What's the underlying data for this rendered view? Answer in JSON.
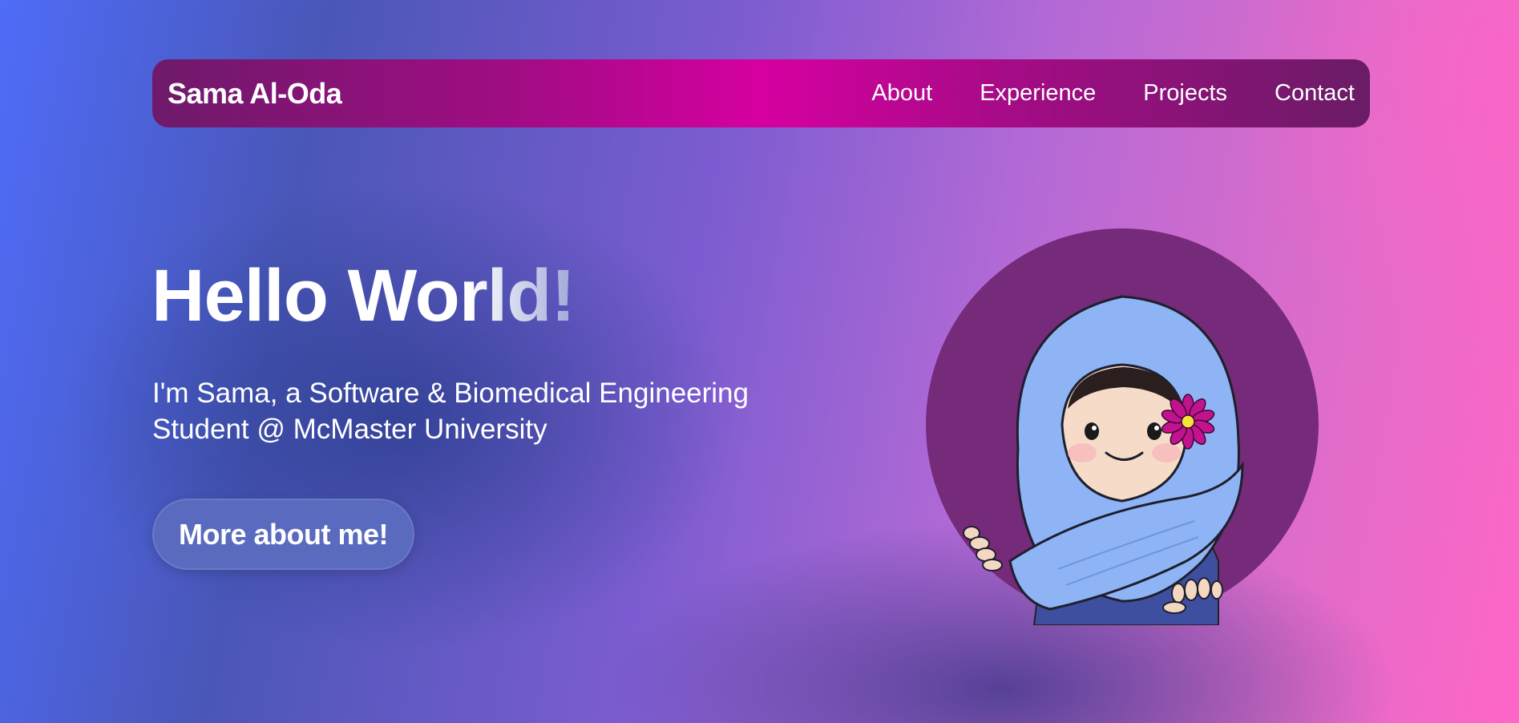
{
  "navbar": {
    "brand": "Sama Al-Oda",
    "links": [
      "About",
      "Experience",
      "Projects",
      "Contact"
    ]
  },
  "hero": {
    "title": "Hello World!",
    "subtitle": "I'm Sama, a Software & Biomedical Engineering Student @ McMaster University",
    "cta_label": "More about me!"
  },
  "colors": {
    "navbar_accent": "#d600a0",
    "button_bg": "#5a6bbf",
    "avatar_circle": "#752a7a",
    "hijab_blue": "#8fb4f5"
  },
  "icons": {
    "avatar": "cartoon-girl-hijab-flower-avatar"
  }
}
